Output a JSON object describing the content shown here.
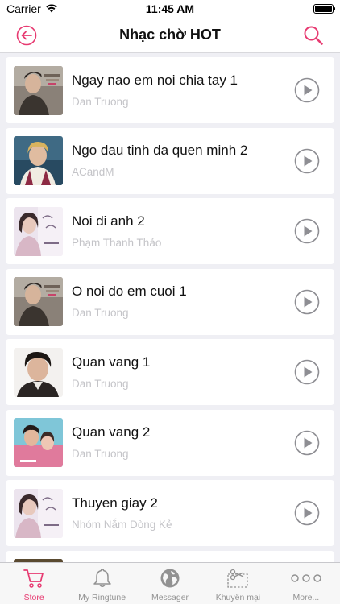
{
  "status": {
    "carrier": "Carrier",
    "time": "11:45 AM"
  },
  "nav": {
    "title": "Nhạc chờ HOT",
    "back_icon": "back-arrow-circle-icon",
    "search_icon": "search-icon"
  },
  "colors": {
    "accent": "#e73a71",
    "muted": "#c4c4c8",
    "tab_inactive": "#929292"
  },
  "songs": [
    {
      "title": "Ngay nao em noi chia tay 1",
      "artist": "Dan Truong"
    },
    {
      "title": "Ngo dau tinh da quen minh 2",
      "artist": "ACandM"
    },
    {
      "title": "Noi di anh 2",
      "artist": "Phạm Thanh Thảo"
    },
    {
      "title": "O noi do em cuoi 1",
      "artist": "Dan Truong"
    },
    {
      "title": "Quan vang 1",
      "artist": "Dan Truong"
    },
    {
      "title": "Quan vang 2",
      "artist": "Dan Truong"
    },
    {
      "title": "Thuyen giay 2",
      "artist": "Nhóm Nắm Dòng Kẻ"
    },
    {
      "title": "",
      "artist": ""
    }
  ],
  "tabs": [
    {
      "label": "Store",
      "icon": "cart-icon",
      "active": true
    },
    {
      "label": "My Ringtune",
      "icon": "bell-icon",
      "active": false
    },
    {
      "label": "Messager",
      "icon": "globe-icon",
      "active": false
    },
    {
      "label": "Khuyến mại",
      "icon": "scissors-coupon-icon",
      "active": false
    },
    {
      "label": "More...",
      "icon": "more-dots-icon",
      "active": false
    }
  ]
}
